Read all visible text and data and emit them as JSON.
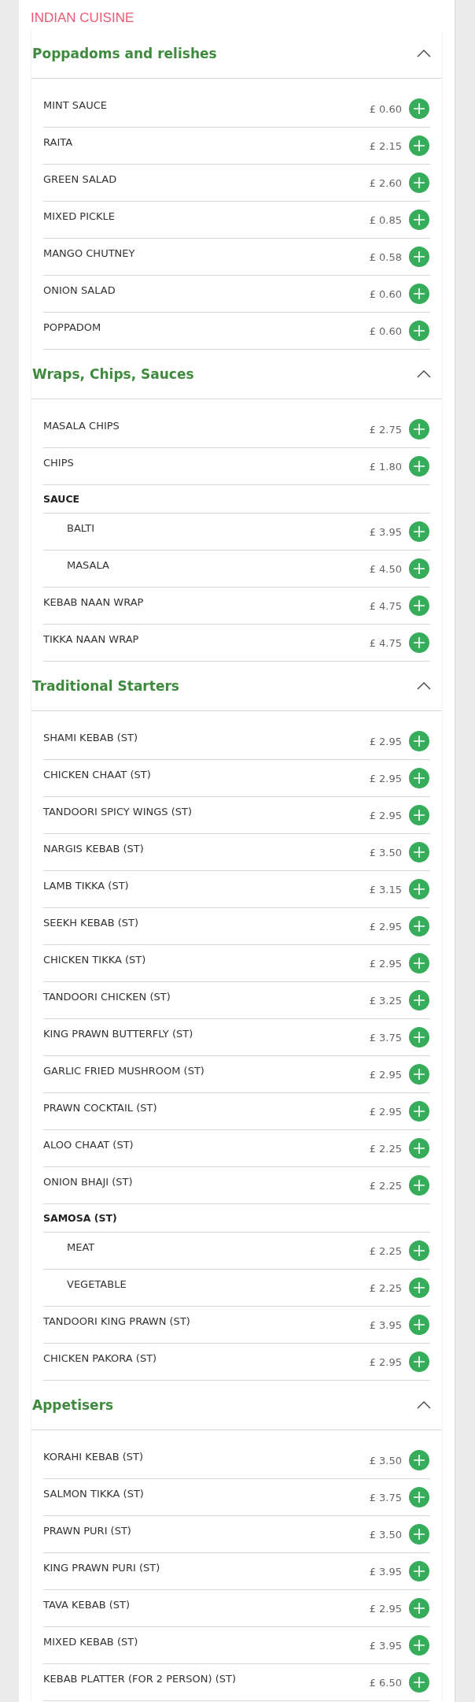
{
  "title": "INDIAN CUISINE",
  "sections": [
    {
      "title": "Poppadoms and relishes",
      "expanded": true,
      "items": [
        {
          "kind": "item",
          "name": "MINT SAUCE",
          "price": "£ 0.60"
        },
        {
          "kind": "item",
          "name": "RAITA",
          "price": "£ 2.15"
        },
        {
          "kind": "item",
          "name": "GREEN SALAD",
          "price": "£ 2.60"
        },
        {
          "kind": "item",
          "name": "MIXED PICKLE",
          "price": "£ 0.85"
        },
        {
          "kind": "item",
          "name": "MANGO CHUTNEY",
          "price": "£ 0.58"
        },
        {
          "kind": "item",
          "name": "ONION SALAD",
          "price": "£ 0.60"
        },
        {
          "kind": "item",
          "name": "POPPADOM",
          "price": "£ 0.60"
        }
      ]
    },
    {
      "title": "Wraps, Chips, Sauces",
      "expanded": true,
      "items": [
        {
          "kind": "item",
          "name": "MASALA CHIPS",
          "price": "£ 2.75"
        },
        {
          "kind": "item",
          "name": "CHIPS",
          "price": "£ 1.80"
        },
        {
          "kind": "group",
          "name": "SAUCE",
          "children": [
            {
              "kind": "item",
              "name": "BALTI",
              "price": "£ 3.95"
            },
            {
              "kind": "item",
              "name": "MASALA",
              "price": "£ 4.50"
            }
          ]
        },
        {
          "kind": "item",
          "name": "KEBAB NAAN WRAP",
          "price": "£ 4.75"
        },
        {
          "kind": "item",
          "name": "TIKKA NAAN WRAP",
          "price": "£ 4.75"
        }
      ]
    },
    {
      "title": "Traditional Starters",
      "expanded": true,
      "items": [
        {
          "kind": "item",
          "name": "SHAMI KEBAB (ST)",
          "price": "£ 2.95"
        },
        {
          "kind": "item",
          "name": "CHICKEN CHAAT (ST)",
          "price": "£ 2.95"
        },
        {
          "kind": "item",
          "name": "TANDOORI SPICY WINGS (ST)",
          "price": "£ 2.95"
        },
        {
          "kind": "item",
          "name": "NARGIS KEBAB (ST)",
          "price": "£ 3.50"
        },
        {
          "kind": "item",
          "name": "LAMB TIKKA (ST)",
          "price": "£ 3.15"
        },
        {
          "kind": "item",
          "name": "SEEKH KEBAB (ST)",
          "price": "£ 2.95"
        },
        {
          "kind": "item",
          "name": "CHICKEN TIKKA (ST)",
          "price": "£ 2.95"
        },
        {
          "kind": "item",
          "name": "TANDOORI CHICKEN (ST)",
          "price": "£ 3.25"
        },
        {
          "kind": "item",
          "name": "KING PRAWN BUTTERFLY (ST)",
          "price": "£ 3.75"
        },
        {
          "kind": "item",
          "name": "GARLIC FRIED MUSHROOM (ST)",
          "price": "£ 2.95"
        },
        {
          "kind": "item",
          "name": "PRAWN COCKTAIL (ST)",
          "price": "£ 2.95"
        },
        {
          "kind": "item",
          "name": "ALOO CHAAT (ST)",
          "price": "£ 2.25"
        },
        {
          "kind": "item",
          "name": "ONION BHAJI (ST)",
          "price": "£ 2.25"
        },
        {
          "kind": "group",
          "name": "SAMOSA (ST)",
          "children": [
            {
              "kind": "item",
              "name": "MEAT",
              "price": "£ 2.25"
            },
            {
              "kind": "item",
              "name": "VEGETABLE",
              "price": "£ 2.25"
            }
          ]
        },
        {
          "kind": "item",
          "name": "TANDOORI KING PRAWN (ST)",
          "price": "£ 3.95"
        },
        {
          "kind": "item",
          "name": "CHICKEN PAKORA (ST)",
          "price": "£ 2.95"
        }
      ]
    },
    {
      "title": "Appetisers",
      "expanded": true,
      "items": [
        {
          "kind": "item",
          "name": "KORAHI KEBAB (ST)",
          "price": "£ 3.50"
        },
        {
          "kind": "item",
          "name": "SALMON TIKKA (ST)",
          "price": "£ 3.75"
        },
        {
          "kind": "item",
          "name": "PRAWN PURI (ST)",
          "price": "£ 3.50"
        },
        {
          "kind": "item",
          "name": "KING PRAWN PURI (ST)",
          "price": "£ 3.95"
        },
        {
          "kind": "item",
          "name": "TAVA KEBAB (ST)",
          "price": "£ 2.95"
        },
        {
          "kind": "item",
          "name": "MIXED KEBAB (ST)",
          "price": "£ 3.95"
        },
        {
          "kind": "item",
          "name": "KEBAB PLATTER (FOR 2 PERSON) (ST)",
          "price": "£ 6.50"
        }
      ]
    }
  ]
}
